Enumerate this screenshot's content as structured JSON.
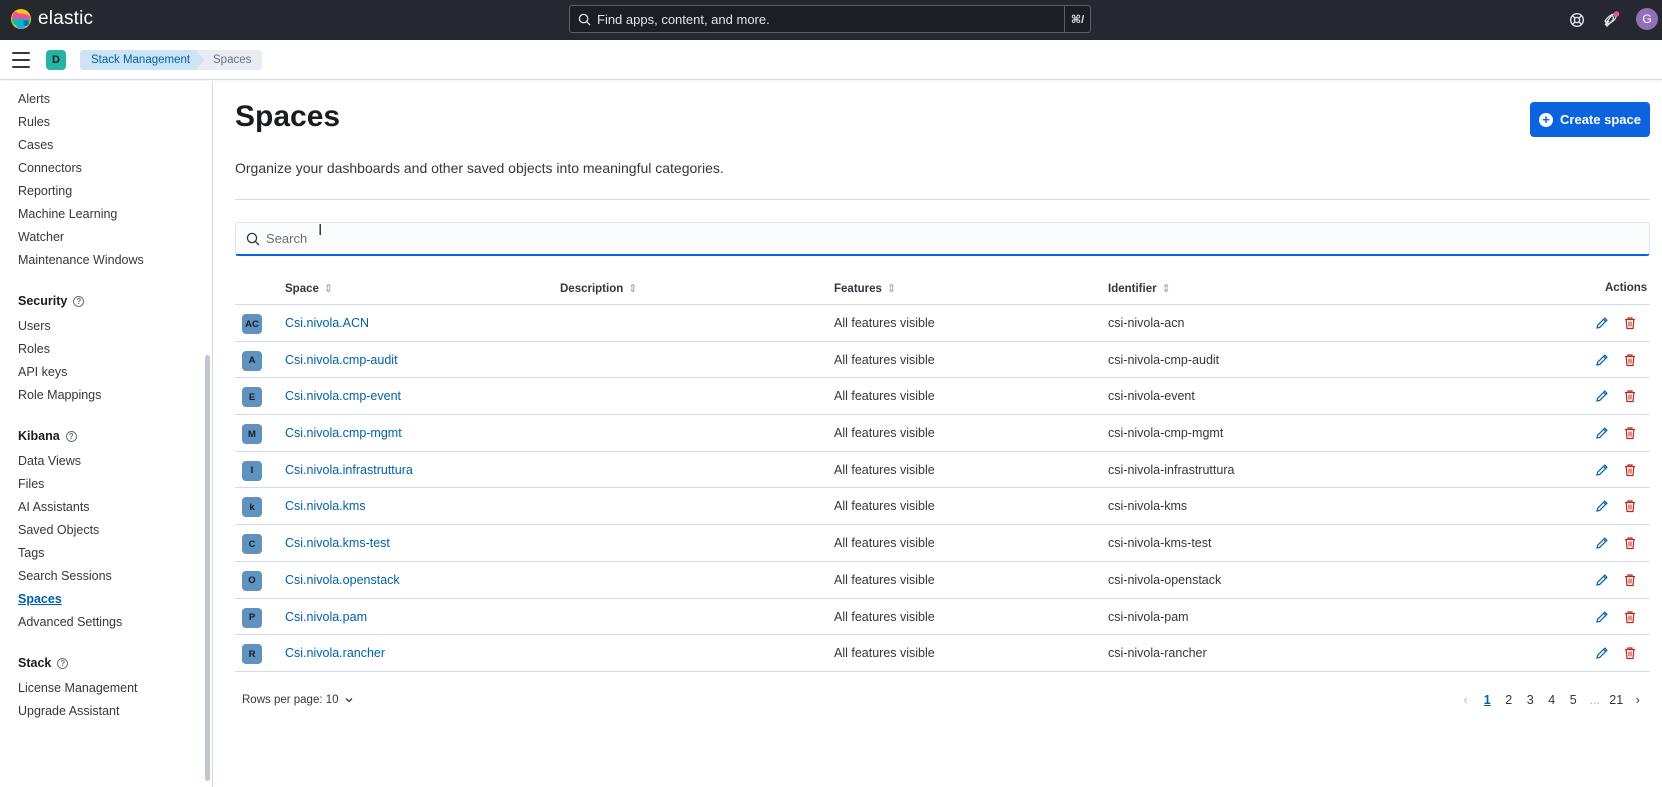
{
  "app": {
    "brand": "elastic",
    "search_placeholder": "Find apps, content, and more.",
    "search_shortcut": "⌘/",
    "user_initial": "G"
  },
  "subheader": {
    "space_initial": "D",
    "breadcrumbs": [
      "Stack Management",
      "Spaces"
    ]
  },
  "sidebar": {
    "top_items": [
      "Alerts",
      "Rules",
      "Cases",
      "Connectors",
      "Reporting",
      "Machine Learning",
      "Watcher",
      "Maintenance Windows"
    ],
    "security": {
      "title": "Security",
      "items": [
        "Users",
        "Roles",
        "API keys",
        "Role Mappings"
      ]
    },
    "kibana": {
      "title": "Kibana",
      "items": [
        "Data Views",
        "Files",
        "AI Assistants",
        "Saved Objects",
        "Tags",
        "Search Sessions",
        "Spaces",
        "Advanced Settings"
      ]
    },
    "stack": {
      "title": "Stack",
      "items": [
        "License Management",
        "Upgrade Assistant"
      ]
    },
    "active": "Spaces"
  },
  "page": {
    "title": "Spaces",
    "create_button": "Create space",
    "description": "Organize your dashboards and other saved objects into meaningful categories.",
    "search_placeholder": "Search"
  },
  "table": {
    "columns": {
      "space": "Space",
      "description": "Description",
      "features": "Features",
      "identifier": "Identifier",
      "actions": "Actions"
    },
    "rows": [
      {
        "initials": "AC",
        "name": "Csi.nivola.ACN",
        "features": "All features visible",
        "identifier": "csi-nivola-acn"
      },
      {
        "initials": "A",
        "name": "Csi.nivola.cmp-audit",
        "features": "All features visible",
        "identifier": "csi-nivola-cmp-audit"
      },
      {
        "initials": "E",
        "name": "Csi.nivola.cmp-event",
        "features": "All features visible",
        "identifier": "csi-nivola-event"
      },
      {
        "initials": "M",
        "name": "Csi.nivola.cmp-mgmt",
        "features": "All features visible",
        "identifier": "csi-nivola-cmp-mgmt"
      },
      {
        "initials": "I",
        "name": "Csi.nivola.infrastruttura",
        "features": "All features visible",
        "identifier": "csi-nivola-infrastruttura"
      },
      {
        "initials": "k",
        "name": "Csi.nivola.kms",
        "features": "All features visible",
        "identifier": "csi-nivola-kms"
      },
      {
        "initials": "C",
        "name": "Csi.nivola.kms-test",
        "features": "All features visible",
        "identifier": "csi-nivola-kms-test"
      },
      {
        "initials": "O",
        "name": "Csi.nivola.openstack",
        "features": "All features visible",
        "identifier": "csi-nivola-openstack"
      },
      {
        "initials": "P",
        "name": "Csi.nivola.pam",
        "features": "All features visible",
        "identifier": "csi-nivola-pam"
      },
      {
        "initials": "R",
        "name": "Csi.nivola.rancher",
        "features": "All features visible",
        "identifier": "csi-nivola-rancher"
      }
    ]
  },
  "pagination": {
    "rows_per_page": "Rows per page: 10",
    "pages": [
      "1",
      "2",
      "3",
      "4",
      "5"
    ],
    "ellipsis": "...",
    "last_page": "21",
    "current": "1"
  },
  "colors": {
    "header_bg": "#25282f",
    "primary": "#0b64dd",
    "link": "#0061a6",
    "danger": "#bd271e",
    "avatar_bg": "#6092c0",
    "space_badge": "#24b4a4"
  }
}
